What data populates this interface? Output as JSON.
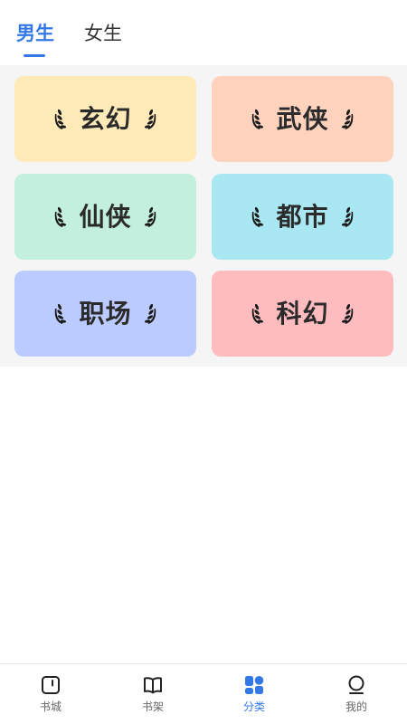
{
  "top_tabs": {
    "male": "男生",
    "female": "女生",
    "active": "male"
  },
  "categories": [
    {
      "label": "玄幻",
      "color": "#ffeab8"
    },
    {
      "label": "武侠",
      "color": "#ffd2be"
    },
    {
      "label": "仙侠",
      "color": "#c3f0dc"
    },
    {
      "label": "都市",
      "color": "#a9e8f3"
    },
    {
      "label": "职场",
      "color": "#bccbff"
    },
    {
      "label": "科幻",
      "color": "#ffbcbf"
    }
  ],
  "bottom_nav": {
    "items": [
      {
        "label": "书城",
        "icon": "bookstore-icon"
      },
      {
        "label": "书架",
        "icon": "bookshelf-icon"
      },
      {
        "label": "分类",
        "icon": "category-icon"
      },
      {
        "label": "我的",
        "icon": "profile-icon"
      }
    ],
    "active_index": 2
  },
  "colors": {
    "accent": "#3478e6",
    "text": "#2b2b2b",
    "inactive": "#666666"
  }
}
